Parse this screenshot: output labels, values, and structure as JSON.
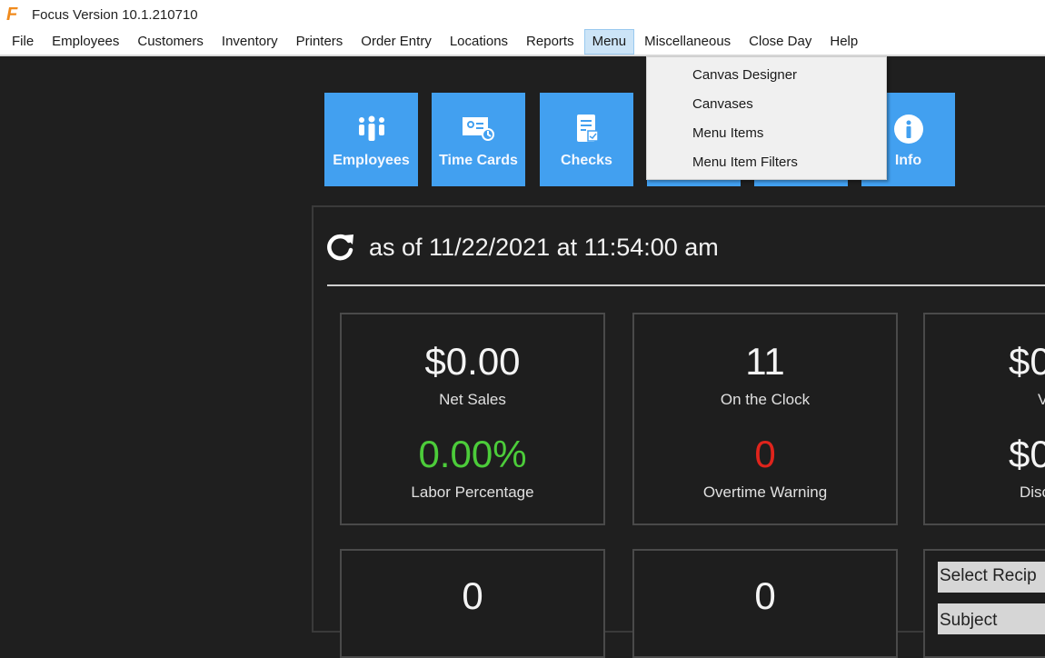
{
  "window": {
    "app_icon": "focus-logo-icon",
    "app_icon_glyph": "F",
    "title": "Focus  Version 10.1.210710"
  },
  "menubar": {
    "items": [
      {
        "label": "File"
      },
      {
        "label": "Employees"
      },
      {
        "label": "Customers"
      },
      {
        "label": "Inventory"
      },
      {
        "label": "Printers"
      },
      {
        "label": "Order Entry"
      },
      {
        "label": "Locations"
      },
      {
        "label": "Reports"
      },
      {
        "label": "Menu",
        "active": true
      },
      {
        "label": "Miscellaneous"
      },
      {
        "label": "Close Day"
      },
      {
        "label": "Help"
      }
    ]
  },
  "menu_dropdown": {
    "parent": "Menu",
    "items": [
      {
        "label": "Canvas Designer"
      },
      {
        "label": "Canvases"
      },
      {
        "label": "Menu Items"
      },
      {
        "label": "Menu Item Filters"
      }
    ]
  },
  "tiles": [
    {
      "label": "Employees",
      "icon": "people-group-icon"
    },
    {
      "label": "Time Cards",
      "icon": "time-card-icon"
    },
    {
      "label": "Checks",
      "icon": "check-receipt-icon"
    },
    {
      "label": "",
      "icon": "hidden-tile"
    },
    {
      "label": "",
      "icon": "hidden-tile"
    },
    {
      "label": "Info",
      "icon": "info-icon"
    }
  ],
  "dashboard": {
    "refresh_icon": "refresh-icon",
    "as_of": "as of 11/22/2021 at 11:54:00 am",
    "cards": [
      {
        "value": "$0.00",
        "label": "Net Sales",
        "value2": "0.00%",
        "label2": "Labor Percentage"
      },
      {
        "value": "11",
        "label": "On the Clock",
        "value2": "0",
        "label2": "Overtime Warning"
      },
      {
        "value": "$0",
        "label": "V",
        "value2": "$0",
        "label2": "Disc"
      }
    ],
    "bottom_cards": [
      {
        "value": "0"
      },
      {
        "value": "0"
      }
    ],
    "message": {
      "recipient_placeholder": "Select Recip",
      "subject_placeholder": "Subject"
    }
  },
  "colors": {
    "tile_blue": "#42a0f0",
    "background": "#1f1f1f",
    "positive_green": "#4ccc3a",
    "warning_red": "#e0241c",
    "menu_highlight": "#cce4f7"
  }
}
